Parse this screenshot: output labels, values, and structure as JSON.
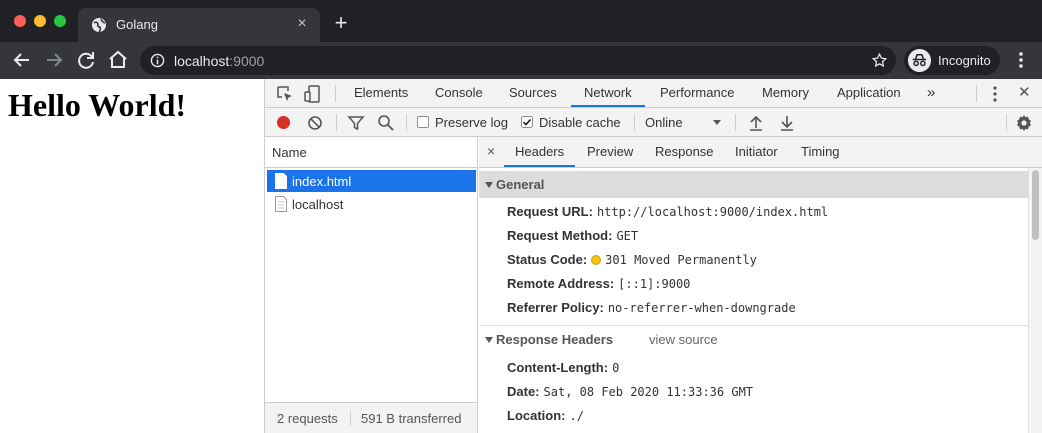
{
  "browser": {
    "tab": {
      "title": "Golang",
      "close": "×"
    },
    "new_tab": "+",
    "omnibox": {
      "host": "localhost",
      "port": ":9000"
    },
    "incognito_label": "Incognito"
  },
  "page": {
    "heading": "Hello World!"
  },
  "devtools": {
    "tabs": [
      "Elements",
      "Console",
      "Sources",
      "Network",
      "Performance",
      "Memory",
      "Application"
    ],
    "active_tab": "Network",
    "more_tabs": "»",
    "close": "✕",
    "controls": {
      "preserve_log": {
        "label": "Preserve log",
        "checked": false
      },
      "disable_cache": {
        "label": "Disable cache",
        "checked": true
      },
      "throttling": "Online"
    },
    "name_panel": {
      "header": "Name",
      "requests": [
        {
          "name": "index.html",
          "selected": true
        },
        {
          "name": "localhost",
          "selected": false
        }
      ],
      "footer": {
        "requests": "2 requests",
        "transferred": "591 B transferred"
      }
    },
    "detail": {
      "close": "×",
      "tabs": [
        "Headers",
        "Preview",
        "Response",
        "Initiator",
        "Timing"
      ],
      "active_tab": "Headers",
      "general": {
        "title": "General",
        "rows": [
          {
            "key": "Request URL:",
            "value": "http://localhost:9000/index.html"
          },
          {
            "key": "Request Method:",
            "value": "GET"
          },
          {
            "key": "Status Code:",
            "value": "301 Moved Permanently"
          },
          {
            "key": "Remote Address:",
            "value": "[::1]:9000"
          },
          {
            "key": "Referrer Policy:",
            "value": "no-referrer-when-downgrade"
          }
        ]
      },
      "response_headers": {
        "title": "Response Headers",
        "view_source": "view source",
        "rows": [
          {
            "key": "Content-Length:",
            "value": "0"
          },
          {
            "key": "Date:",
            "value": "Sat, 08 Feb 2020 11:33:36 GMT"
          },
          {
            "key": "Location:",
            "value": "./"
          }
        ]
      }
    }
  },
  "colors": {
    "accent": "#1a73e8",
    "record": "#d93025",
    "status_warning": "#f4c20d",
    "chrome_dark": "#202124",
    "chrome_toolbar": "#35363a"
  }
}
